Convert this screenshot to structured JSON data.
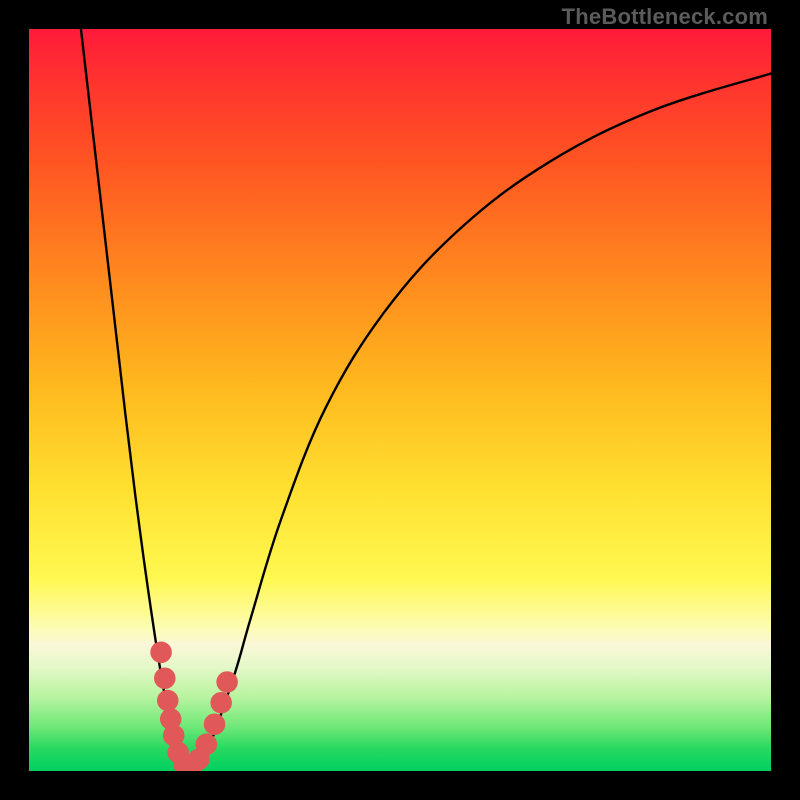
{
  "watermark": "TheBottleneck.com",
  "chart_data": {
    "type": "line",
    "title": "",
    "xlabel": "",
    "ylabel": "",
    "xlim": [
      0,
      100
    ],
    "ylim": [
      0,
      100
    ],
    "series": [
      {
        "name": "curve",
        "x": [
          7,
          10,
          13,
          15,
          17,
          18.5,
          19.5,
          20.5,
          21.5,
          23,
          24.5,
          26,
          28,
          30,
          34,
          40,
          48,
          58,
          70,
          84,
          100
        ],
        "y": [
          100,
          74,
          48,
          32,
          18,
          9,
          4,
          1,
          0.3,
          1.5,
          4,
          8,
          14,
          21,
          34,
          49,
          62,
          73,
          82,
          89,
          94
        ]
      }
    ],
    "markers": [
      {
        "x": 17.8,
        "y": 16.0
      },
      {
        "x": 18.3,
        "y": 12.5
      },
      {
        "x": 18.7,
        "y": 9.5
      },
      {
        "x": 19.1,
        "y": 7.0
      },
      {
        "x": 19.5,
        "y": 4.8
      },
      {
        "x": 20.1,
        "y": 2.5
      },
      {
        "x": 20.9,
        "y": 0.9
      },
      {
        "x": 21.9,
        "y": 0.5
      },
      {
        "x": 22.9,
        "y": 1.6
      },
      {
        "x": 23.9,
        "y": 3.6
      },
      {
        "x": 25.0,
        "y": 6.3
      },
      {
        "x": 25.9,
        "y": 9.2
      },
      {
        "x": 26.7,
        "y": 12.0
      }
    ],
    "marker_style": {
      "color": "#e05858",
      "radius_pct": 1.45
    }
  }
}
